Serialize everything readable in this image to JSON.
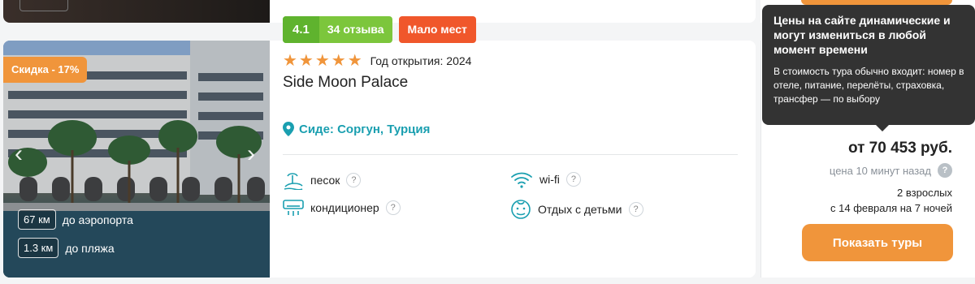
{
  "hotel": {
    "discount": "Скидка - 17%",
    "distances": [
      {
        "value": "67 км",
        "label": "до аэропорта"
      },
      {
        "value": "1.3 км",
        "label": "до пляжа"
      }
    ],
    "rating": "4.1",
    "reviews": "34 отзыва",
    "availability_badge": "Мало мест",
    "stars": "★★★★★",
    "opened": "Год открытия: 2024",
    "name": "Side Moon Palace",
    "location": "Сиде: Соргун, Турция",
    "amenities": [
      {
        "label": "песок",
        "icon": "sand-beach-icon"
      },
      {
        "label": "кондиционер",
        "icon": "air-conditioner-icon"
      },
      {
        "label": "wi-fi",
        "icon": "wifi-icon"
      },
      {
        "label": "Отдых с детьми",
        "icon": "child-face-icon"
      }
    ],
    "help_mark": "?"
  },
  "price_panel": {
    "price": "от 70 453 руб.",
    "price_time": "цена 10 минут назад",
    "pax": "2 взрослых",
    "dates": "с 14 февраля на 7 ночей",
    "button": "Показать туры"
  },
  "tooltip": {
    "title": "Цены на сайте динамические и могут измениться в любой момент времени",
    "body": "В стоимость тура обычно входит: номер в отеле, питание, перелёты, страховка, трансфер — по выбору"
  },
  "colors": {
    "accent_orange": "#f0953b",
    "rating_green": "#7cc63c",
    "alert_red": "#f0572b",
    "location_teal": "#1a9fb0",
    "tooltip_bg": "#333333"
  }
}
